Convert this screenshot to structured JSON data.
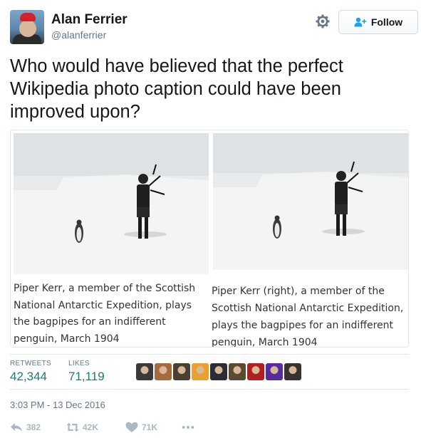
{
  "user": {
    "display_name": "Alan Ferrier",
    "handle": "@alanferrier"
  },
  "header": {
    "follow_label": "Follow"
  },
  "tweet": {
    "text": "Who would have believed that the perfect Wikipedia photo caption could have been improved upon?",
    "timestamp": "3:03 PM - 13 Dec 2016"
  },
  "media": {
    "left_caption": "Piper Kerr, a member of the Scottish National Antarctic Expedition, plays the bagpipes for an indifferent penguin, March 1904",
    "right_caption": "Piper Kerr (right), a member of the Scottish National Antarctic Expedition, plays the bagpipes for an indifferent penguin, March 1904"
  },
  "stats": {
    "retweets_label": "RETWEETS",
    "retweets_value": "42,344",
    "likes_label": "LIKES",
    "likes_value": "71,119"
  },
  "likers": [
    "#3a3a3a",
    "#a66a3c",
    "#4a4030",
    "#e8a030",
    "#2c2c34",
    "#5a4a30",
    "#b02020",
    "#5a2aa0",
    "#3a3030"
  ],
  "actions": {
    "reply_count": "382",
    "retweet_count": "42K",
    "like_count": "71K"
  },
  "colors": {
    "accent": "#1da1f2",
    "stat_number": "#1c7c71",
    "muted": "#657786",
    "icon": "#aab8c2"
  },
  "icons": {
    "settings": "gear-icon",
    "follow": "add-user-icon",
    "reply": "reply-icon",
    "retweet": "retweet-icon",
    "like": "heart-icon",
    "more": "more-icon"
  }
}
